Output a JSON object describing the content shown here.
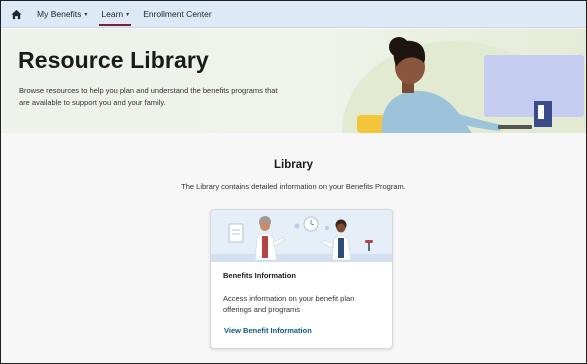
{
  "nav": {
    "home_icon": "home-icon",
    "items": [
      {
        "label": "My Benefits",
        "has_caret": true
      },
      {
        "label": "Learn",
        "has_caret": true,
        "active": true
      },
      {
        "label": "Enrollment Center",
        "has_caret": false
      }
    ],
    "caret_glyph": "▾",
    "active_color": "#7e1f3a"
  },
  "hero": {
    "title": "Resource Library",
    "description": "Browse resources to help you plan and understand the benefits programs that are available to support you and your family.",
    "illustration": "woman-at-computer-illustration"
  },
  "library": {
    "title": "Library",
    "subtitle": "The Library contains detailed information on your Benefits Program."
  },
  "card": {
    "illustration": "doctors-illustration",
    "title": "Benefits Information",
    "description": "Access information on your benefit plan offerings and programs",
    "link_label": "View Benefit Information",
    "link_color": "#0f5b83"
  }
}
